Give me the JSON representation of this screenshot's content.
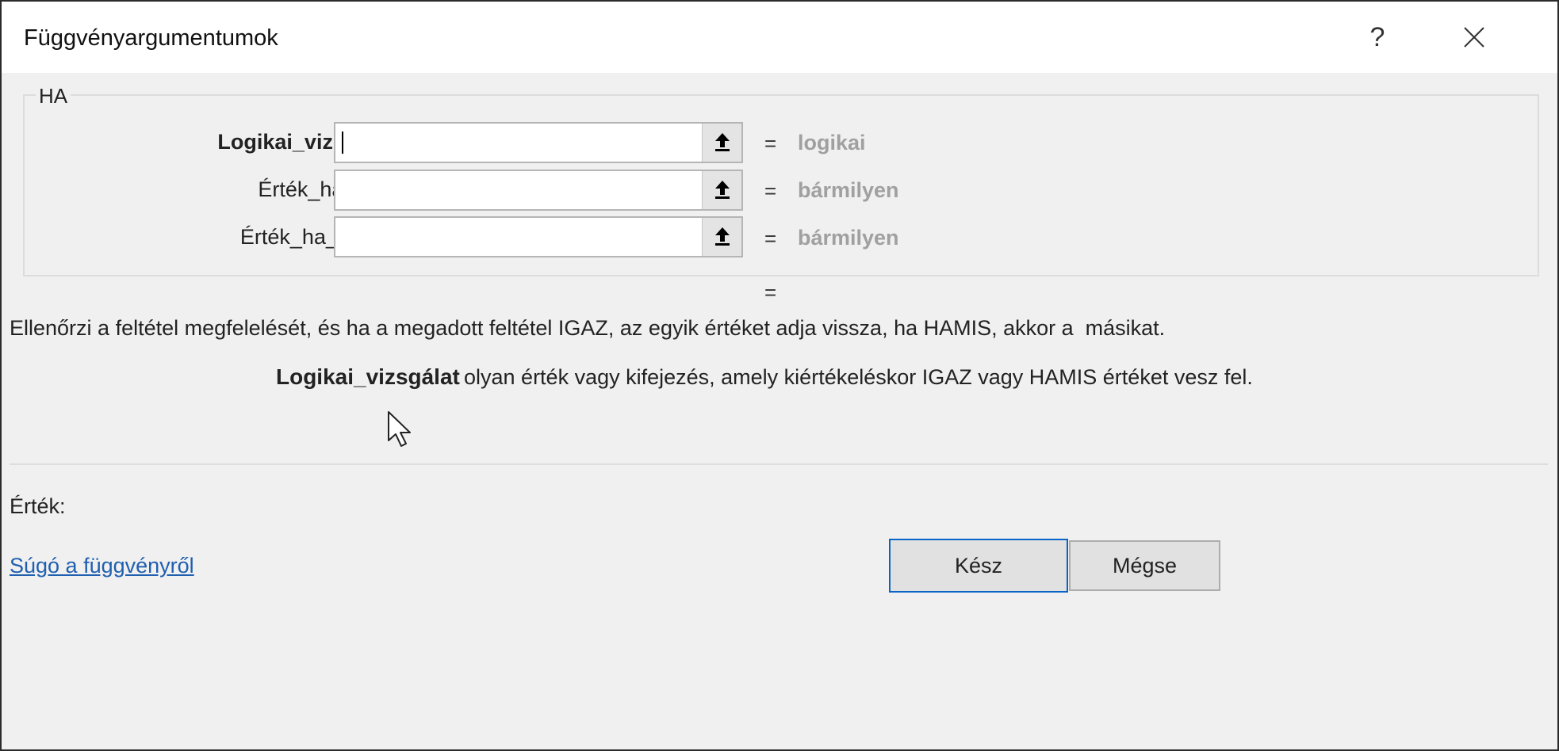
{
  "dialog": {
    "title": "Függvényargumentumok",
    "help_button": "?",
    "close_icon": "close-icon"
  },
  "function_group": {
    "label": "HA",
    "arguments": [
      {
        "label": "Logikai_vizsgálat",
        "value": "",
        "equals": "=",
        "type": "logikai",
        "bold": true,
        "focused": true
      },
      {
        "label": "Érték_ha_igaz",
        "value": "",
        "equals": "=",
        "type": "bármilyen",
        "bold": false
      },
      {
        "label": "Érték_ha_hamis",
        "value": "",
        "equals": "=",
        "type": "bármilyen",
        "bold": false
      }
    ],
    "ref_icon": "collapse-dialog-icon"
  },
  "result_equals": "=",
  "description": "Ellenőrzi a feltétel megfelelését, és ha a megadott feltétel IGAZ, az egyik értéket adja vissza, ha HAMIS, akkor a  másikat.",
  "argument_help": {
    "name": "Logikai_vizsgálat",
    "text": "olyan érték vagy kifejezés, amely kiértékeléskor IGAZ vagy HAMIS értéket vesz fel."
  },
  "value": {
    "label": "Érték:",
    "result": ""
  },
  "help_link": "Súgó a függvényről",
  "buttons": {
    "ok": "Kész",
    "cancel": "Mégse"
  },
  "colors": {
    "link": "#1f5fb0",
    "default_button_border": "#0a64c8",
    "type_text": "#a0a0a0"
  }
}
